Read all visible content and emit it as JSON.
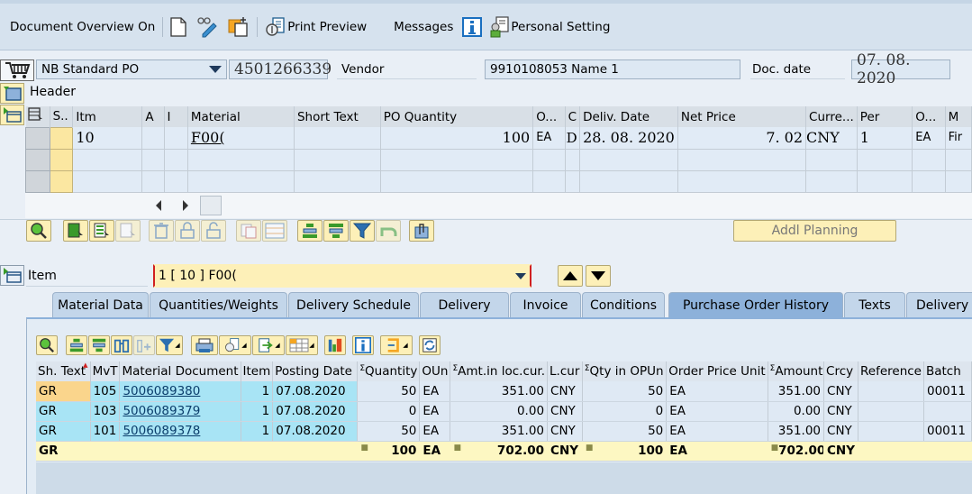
{
  "toolbar": {
    "doc_overview": "Document Overview On",
    "print_preview": "Print Preview",
    "messages": "Messages",
    "personal_setting": "Personal Setting"
  },
  "header_row": {
    "doc_type": "NB Standard PO",
    "po_number": "4501266339",
    "vendor_label": "Vendor",
    "vendor_value": "9910108053 Name 1",
    "doc_date_label": "Doc. date",
    "doc_date_value": "07. 08. 2020"
  },
  "header_section": {
    "label": "Header"
  },
  "item_grid": {
    "columns": [
      "S..",
      "Itm",
      "A",
      "I",
      "Material",
      "Short Text",
      "PO Quantity",
      "O...",
      "C",
      "Deliv. Date",
      "Net Price",
      "Curre...",
      "Per",
      "O...",
      "M"
    ],
    "rows": [
      {
        "itm": "10",
        "a": "",
        "i": "",
        "material": "F00(",
        "short_text": "",
        "po_qty": "100",
        "oun": "EA",
        "c": "D",
        "deliv_date": "28. 08. 2020",
        "net_price": "7. 02",
        "currency": "CNY",
        "per": "1",
        "opu": "EA",
        "m": "Fir"
      }
    ]
  },
  "addl_planning": "Addl Planning",
  "item_section": {
    "label": "Item",
    "selector_value": "1 [ 10 ] F00("
  },
  "tabs": [
    {
      "label": "Material Data",
      "active": false
    },
    {
      "label": "Quantities/Weights",
      "active": false
    },
    {
      "label": "Delivery Schedule",
      "active": false
    },
    {
      "label": "Delivery",
      "active": false
    },
    {
      "label": "Invoice",
      "active": false
    },
    {
      "label": "Conditions",
      "active": false
    },
    {
      "label": "Purchase Order History",
      "active": true
    },
    {
      "label": "Texts",
      "active": false
    },
    {
      "label": "Delivery A",
      "active": false
    }
  ],
  "history": {
    "columns": {
      "sh_text": "Sh. Text",
      "mvt": "MvT",
      "mat_doc": "Material Document",
      "item": "Item",
      "posting_date": "Posting Date",
      "quantity": "Quantity",
      "oun": "OUn",
      "amt_loc": "Amt.in loc.cur.",
      "lcur": "L.cur",
      "qty_opun": "Qty in OPUn",
      "opu": "Order Price Unit",
      "amount": "Amount",
      "crcy": "Crcy",
      "reference": "Reference",
      "batch": "Batch"
    },
    "rows": [
      {
        "sh_text": "GR",
        "mvt": "105",
        "mat_doc": "5006089380",
        "item": "1",
        "posting_date": "07.08.2020",
        "quantity": "50",
        "oun": "EA",
        "amt_loc": "351.00",
        "lcur": "CNY",
        "qty_opun": "50",
        "opu": "EA",
        "amount": "351.00",
        "crcy": "CNY",
        "reference": "",
        "batch": "00011"
      },
      {
        "sh_text": "GR",
        "mvt": "103",
        "mat_doc": "5006089379",
        "item": "1",
        "posting_date": "07.08.2020",
        "quantity": "0",
        "oun": "EA",
        "amt_loc": "0.00",
        "lcur": "CNY",
        "qty_opun": "0",
        "opu": "EA",
        "amount": "0.00",
        "crcy": "CNY",
        "reference": "",
        "batch": ""
      },
      {
        "sh_text": "GR",
        "mvt": "101",
        "mat_doc": "5006089378",
        "item": "1",
        "posting_date": "07.08.2020",
        "quantity": "50",
        "oun": "EA",
        "amt_loc": "351.00",
        "lcur": "CNY",
        "qty_opun": "50",
        "opu": "EA",
        "amount": "351.00",
        "crcy": "CNY",
        "reference": "",
        "batch": "00011"
      }
    ],
    "total": {
      "sh_text": "GR",
      "quantity": "100",
      "oun": "EA",
      "amt_loc": "702.00",
      "lcur": "CNY",
      "qty_opun": "100",
      "opu": "EA",
      "amount": "702.00",
      "crcy": "CNY"
    }
  },
  "colors": {
    "toolbar_bg": "#d6e2ee",
    "page_bg": "#e9eff6",
    "button_yellow": "#fdf0b8",
    "active_tab": "#8db1da",
    "row_cyan": "#a8e4f5",
    "row_orange": "#fad58c",
    "total_row": "#fdf7c2"
  }
}
